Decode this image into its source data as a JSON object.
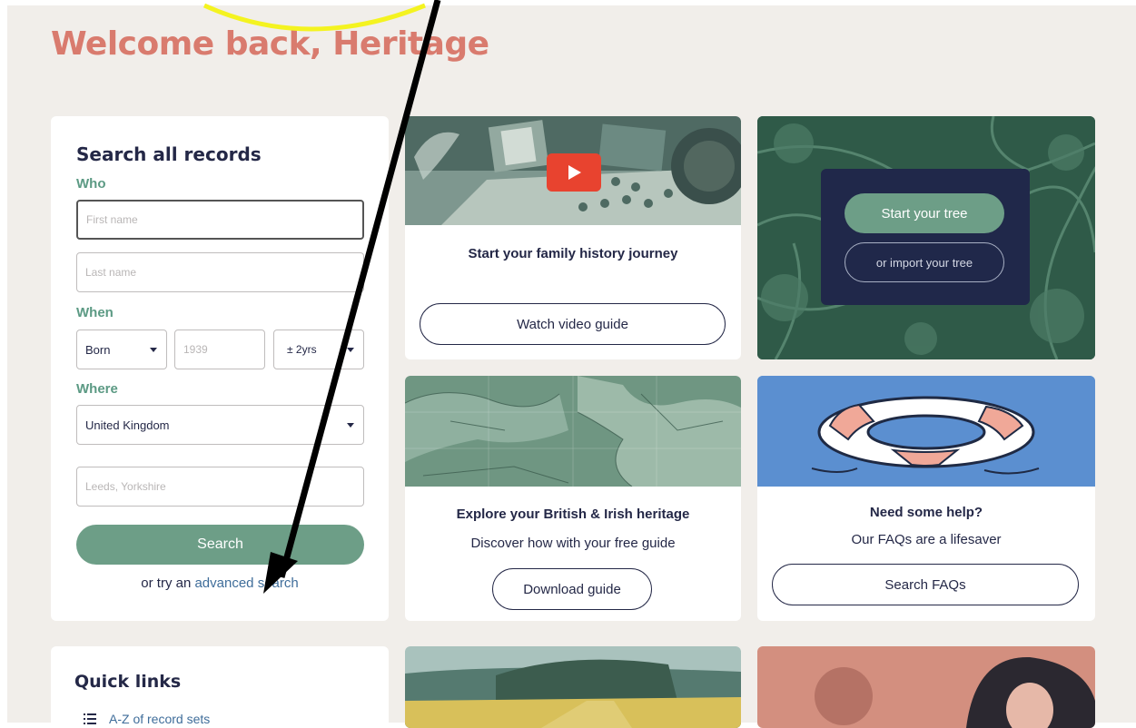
{
  "welcome": "Welcome back, Heritage",
  "search": {
    "title": "Search all records",
    "who_label": "Who",
    "first_name_placeholder": "First name",
    "last_name_placeholder": "Last name",
    "when_label": "When",
    "event_select": "Born",
    "year_placeholder": "1939",
    "range_select": "± 2yrs",
    "where_label": "Where",
    "country_select": "United Kingdom",
    "place_placeholder": "Leeds, Yorkshire",
    "search_button": "Search",
    "advanced_prefix": "or try an ",
    "advanced_link": "advanced search"
  },
  "video_card": {
    "heading": "Start your family history journey",
    "button": "Watch video guide"
  },
  "tree_card": {
    "start_button": "Start your tree",
    "import_button": "or import your tree"
  },
  "map_card": {
    "heading": "Explore your British & Irish heritage",
    "subtext": "Discover how with your free guide",
    "button": "Download guide"
  },
  "help_card": {
    "heading": "Need some help?",
    "subtext": "Our FAQs are a lifesaver",
    "button": "Search FAQs"
  },
  "quick_links": {
    "title": "Quick links",
    "items": [
      "A-Z of record sets"
    ]
  },
  "colors": {
    "brand_salmon": "#d97b6e",
    "accent_green": "#6d9e87",
    "navy": "#242847",
    "page_bg": "#f1eeea",
    "annotation_yellow": "#f4f320"
  },
  "icons": {
    "play": "play-icon",
    "caret": "chevron-down-icon",
    "list": "list-icon"
  }
}
